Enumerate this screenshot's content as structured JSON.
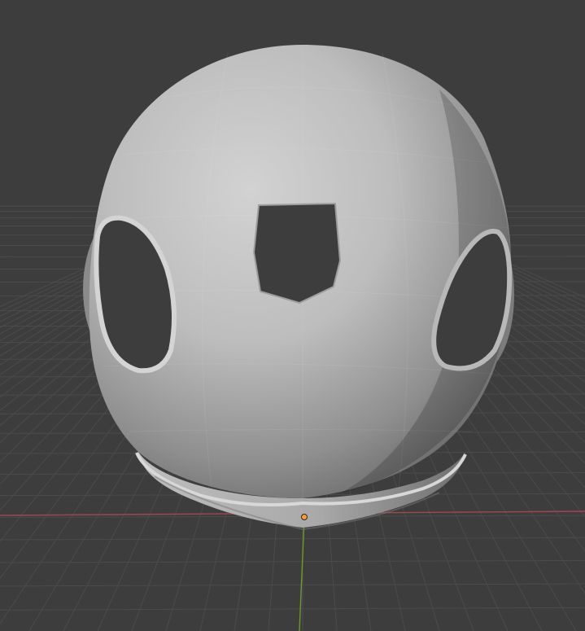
{
  "viewport": {
    "background_color": "#3d3d3d",
    "grid_color": "#4b4b4b",
    "x_axis_color": "#a3474f",
    "y_axis_color": "#6c9b2a",
    "origin_color": "#ff9a2e",
    "mesh_light_color": "#c8c8c8",
    "mesh_mid_color": "#a8a8a8",
    "mesh_shadow_color": "#6e6e6e",
    "hole_color": "#3d3d3d"
  }
}
